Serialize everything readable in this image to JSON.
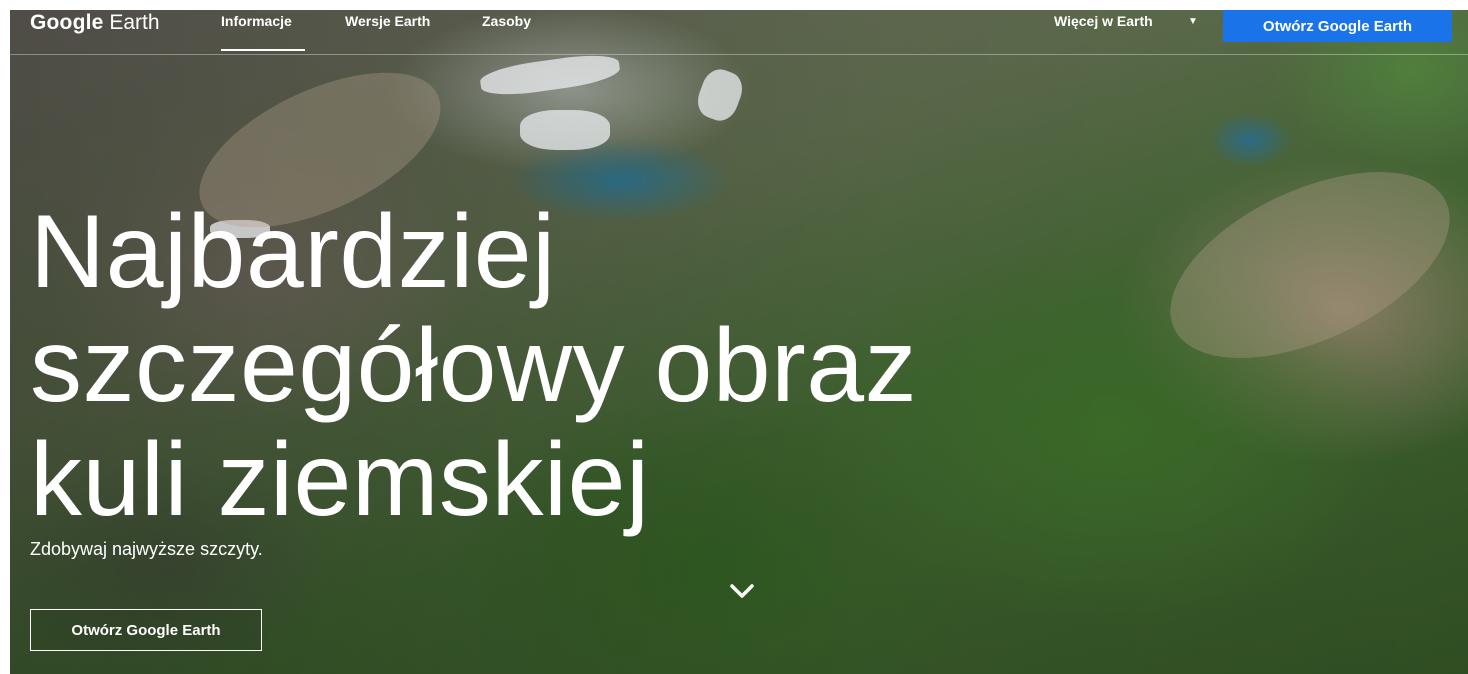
{
  "header": {
    "logo_brand": "Google",
    "logo_product": "Earth",
    "nav": [
      {
        "label": "Informacje",
        "active": true
      },
      {
        "label": "Wersje Earth",
        "active": false
      },
      {
        "label": "Zasoby",
        "active": false
      }
    ],
    "more_label": "Więcej w Earth",
    "more_icon": "caret-down-icon",
    "open_button_label": "Otwórz Google Earth",
    "accent_color": "#1a73e8"
  },
  "hero": {
    "headline_lines": [
      "Najbardziej",
      "szczegółowy obraz",
      "kuli ziemskiej"
    ],
    "subheadline": "Zdobywaj najwyższe szczyty.",
    "scroll_icon": "chevron-down-icon",
    "open_button_label": "Otwórz Google Earth"
  }
}
